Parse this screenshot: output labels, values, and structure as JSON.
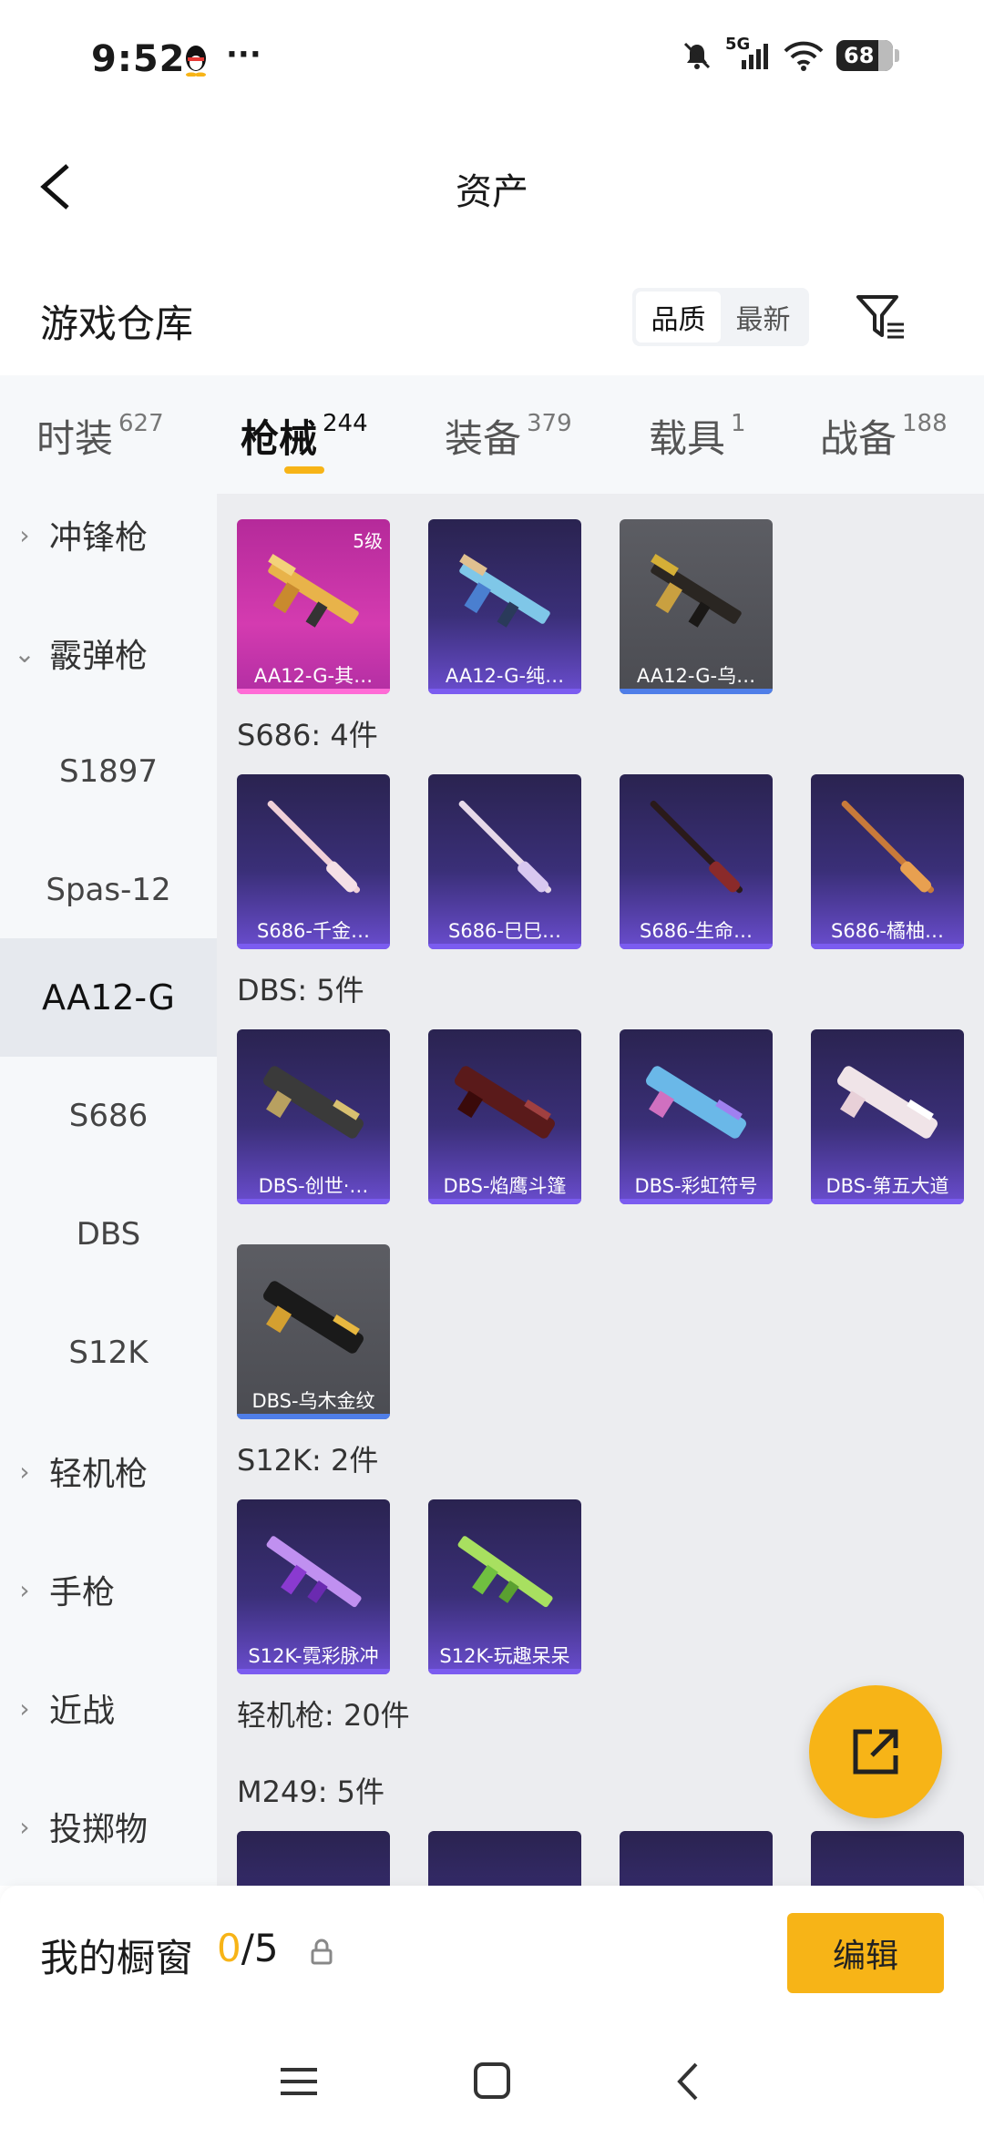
{
  "status_bar": {
    "time": "9:52",
    "network": "5G",
    "battery": "68"
  },
  "header": {
    "title": "资产"
  },
  "warehouse": {
    "title": "游戏仓库",
    "sort_options": [
      {
        "label": "品质",
        "active": true
      },
      {
        "label": "最新",
        "active": false
      }
    ]
  },
  "tabs": [
    {
      "label": "时装",
      "count": "627"
    },
    {
      "label": "枪械",
      "count": "244"
    },
    {
      "label": "装备",
      "count": "379"
    },
    {
      "label": "载具",
      "count": "1"
    },
    {
      "label": "战备",
      "count": "188"
    }
  ],
  "sidebar": {
    "items": [
      {
        "label": "冲锋枪"
      },
      {
        "label": "霰弹枪"
      },
      {
        "label": "S1897"
      },
      {
        "label": "Spas-12"
      },
      {
        "label": "AA12-G"
      },
      {
        "label": "S686"
      },
      {
        "label": "DBS"
      },
      {
        "label": "S12K"
      },
      {
        "label": "轻机枪"
      },
      {
        "label": "手枪"
      },
      {
        "label": "近战"
      },
      {
        "label": "投掷物"
      }
    ]
  },
  "main": {
    "aa12_cards": [
      {
        "name": "AA12-G-其…",
        "badge": "5级"
      },
      {
        "name": "AA12-G-纯…"
      },
      {
        "name": "AA12-G-乌…"
      }
    ],
    "s686_label": "S686: 4件",
    "s686_cards": [
      {
        "name": "S686-千金…"
      },
      {
        "name": "S686-巳巳…"
      },
      {
        "name": "S686-生命…"
      },
      {
        "name": "S686-橘柚…"
      }
    ],
    "dbs_label": "DBS: 5件",
    "dbs_cards": [
      {
        "name": "DBS-创世·…"
      },
      {
        "name": "DBS-焰鹰斗篷"
      },
      {
        "name": "DBS-彩虹符号"
      },
      {
        "name": "DBS-第五大道"
      },
      {
        "name": "DBS-乌木金纹"
      }
    ],
    "s12k_label": "S12K: 2件",
    "s12k_cards": [
      {
        "name": "S12K-霓彩脉冲"
      },
      {
        "name": "S12K-玩趣呆呆"
      }
    ],
    "lmg_label": "轻机枪: 20件",
    "m249_label": "M249: 5件"
  },
  "showcase": {
    "title": "我的橱窗",
    "current": "0",
    "total": "/5",
    "edit_label": "编辑"
  },
  "colors": {
    "accent": "#f7b417",
    "card_purple": "#3a2f78",
    "card_pink": "#d43bb0",
    "card_gray": "#54555b"
  }
}
